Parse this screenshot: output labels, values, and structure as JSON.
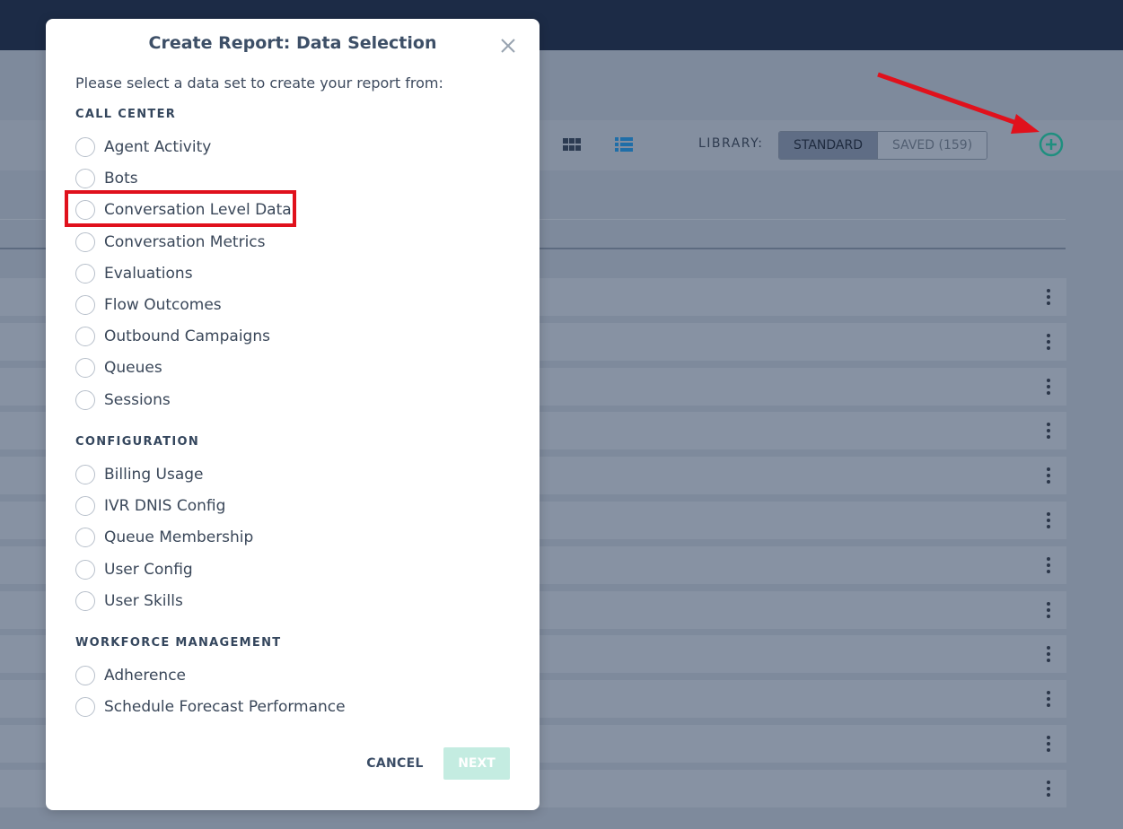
{
  "toolbar": {
    "library_label": "LIBRARY:",
    "standard_label": "STANDARD",
    "saved_label": "SAVED (159)",
    "accent_color": "#1f8f7f",
    "icons": [
      "grid-view-icon",
      "list-view-icon",
      "add-circle-icon",
      "annotation-arrow"
    ]
  },
  "background_rows": {
    "count": 12,
    "row_icon": "kebab-menu-icon"
  },
  "modal": {
    "title": "Create Report: Data Selection",
    "close_icon": "close-icon",
    "prompt": "Please select a data set to create your report from:",
    "sections": [
      {
        "heading": "CALL CENTER",
        "options": [
          "Agent Activity",
          "Bots",
          "Conversation Level Data",
          "Conversation Metrics",
          "Evaluations",
          "Flow Outcomes",
          "Outbound Campaigns",
          "Queues",
          "Sessions"
        ]
      },
      {
        "heading": "CONFIGURATION",
        "options": [
          "Billing Usage",
          "IVR DNIS Config",
          "Queue Membership",
          "User Config",
          "User Skills"
        ]
      },
      {
        "heading": "WORKFORCE MANAGEMENT",
        "options": [
          "Adherence",
          "Schedule Forecast Performance"
        ]
      }
    ],
    "highlighted_option": "Conversation Level Data",
    "highlight_color": "#e0111c",
    "cancel_label": "CANCEL",
    "next_label": "NEXT"
  }
}
